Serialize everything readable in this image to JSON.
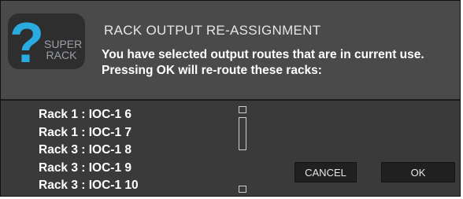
{
  "dialog": {
    "logo": {
      "icon": "question-mark-icon",
      "line1": "SUPER",
      "line2": "RACK"
    },
    "title": "RACK OUTPUT RE-ASSIGNMENT",
    "message": "You have selected output routes that are in current use. Pressing OK will re-route these racks:",
    "routes": [
      "Rack 1 : IOC-1 6",
      "Rack 1 : IOC-1 7",
      "Rack 3 : IOC-1 8",
      "Rack 3 : IOC-1 9",
      "Rack 3 : IOC-1 10"
    ],
    "buttons": {
      "cancel": "CANCEL",
      "ok": "OK"
    },
    "colors": {
      "accent": "#29abe2",
      "header_bg": "#4a4a4a",
      "body_bg": "#3a3a3a"
    }
  }
}
